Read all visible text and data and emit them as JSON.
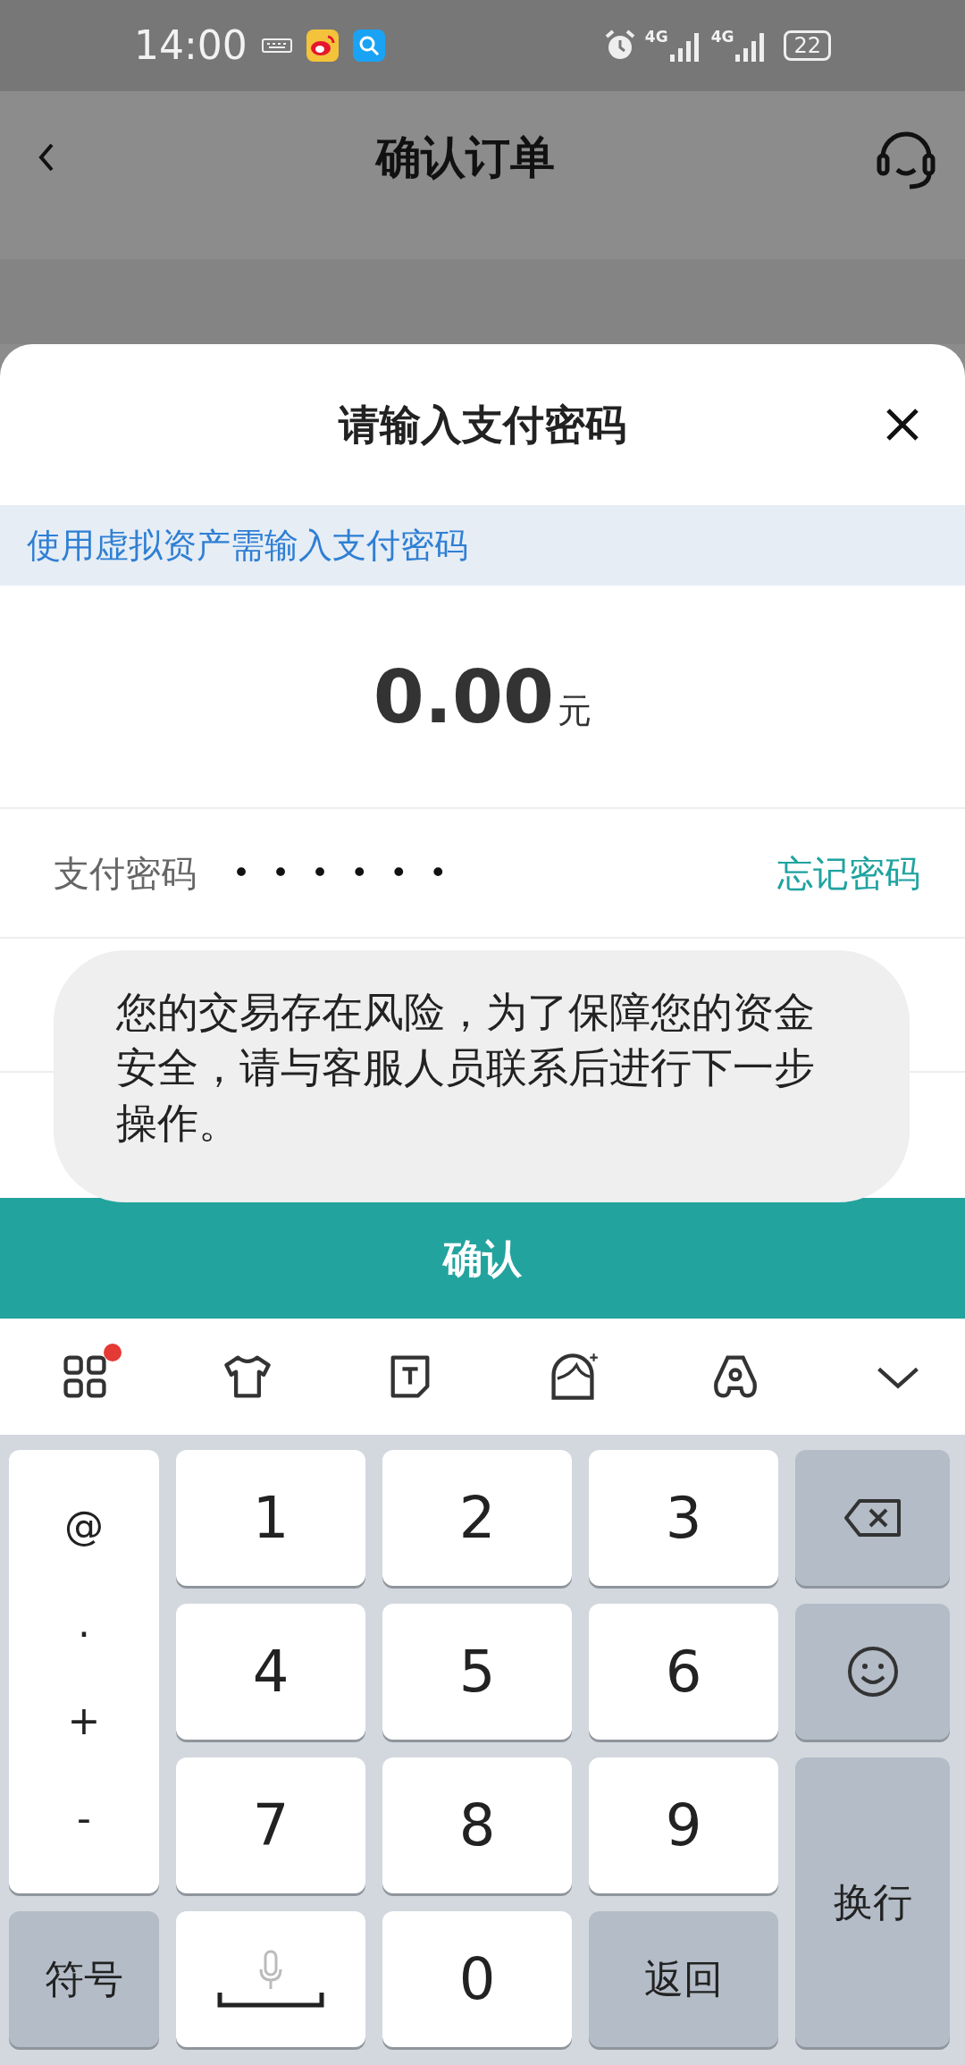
{
  "status_bar": {
    "time": "14:00",
    "network_labels": [
      "4G",
      "4G"
    ],
    "battery": "22"
  },
  "header": {
    "title": "确认订单"
  },
  "sheet": {
    "title": "请输入支付密码",
    "notice": "使用虚拟资产需输入支付密码",
    "amount": "0.00",
    "currency": "元",
    "password": {
      "label": "支付密码",
      "value": "••••••",
      "forgot_link": "忘记密码"
    },
    "confirm_button": "确认"
  },
  "toast": {
    "text": "您的交易存在风险，为了保障您的资金安全，请与客服人员联系后进行下一步操作。"
  },
  "keyboard_toolbar": [
    {
      "kind": "apps",
      "badge": true
    },
    {
      "kind": "skin",
      "badge": false
    },
    {
      "kind": "text",
      "badge": false
    },
    {
      "kind": "avatar",
      "badge": false
    },
    {
      "kind": "handwrite",
      "badge": false
    },
    {
      "kind": "collapse",
      "badge": false
    }
  ],
  "keyboard": [
    {
      "kind": "symbols",
      "labels": [
        "@",
        ".",
        "+",
        "-"
      ]
    },
    {
      "kind": "digit",
      "label": "1"
    },
    {
      "kind": "digit",
      "label": "2"
    },
    {
      "kind": "digit",
      "label": "3"
    },
    {
      "kind": "backspace"
    },
    {
      "kind": "digit",
      "label": "4"
    },
    {
      "kind": "digit",
      "label": "5"
    },
    {
      "kind": "digit",
      "label": "6"
    },
    {
      "kind": "emoji"
    },
    {
      "kind": "digit",
      "label": "7"
    },
    {
      "kind": "digit",
      "label": "8"
    },
    {
      "kind": "digit",
      "label": "9"
    },
    {
      "kind": "enter",
      "label": "换行"
    },
    {
      "kind": "function",
      "label": "符号"
    },
    {
      "kind": "space"
    },
    {
      "kind": "digit",
      "label": "0"
    },
    {
      "kind": "function",
      "label": "返回"
    }
  ]
}
